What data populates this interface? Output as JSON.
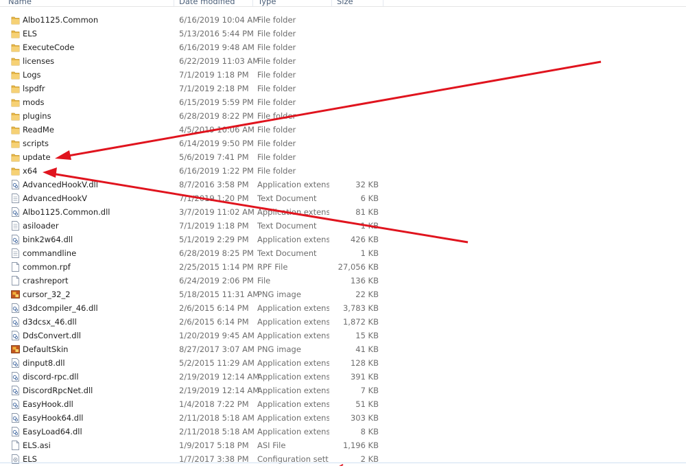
{
  "columns": {
    "name": "Name",
    "date_modified": "Date modified",
    "type": "Type",
    "size": "Size"
  },
  "files": [
    {
      "name": "Albo1125.Common",
      "date": "6/16/2019 10:04 AM",
      "type": "File folder",
      "size": "",
      "icon": "folder-icon"
    },
    {
      "name": "ELS",
      "date": "5/13/2016 5:44 PM",
      "type": "File folder",
      "size": "",
      "icon": "folder-icon"
    },
    {
      "name": "ExecuteCode",
      "date": "6/16/2019 9:48 AM",
      "type": "File folder",
      "size": "",
      "icon": "folder-icon"
    },
    {
      "name": "licenses",
      "date": "6/22/2019 11:03 AM",
      "type": "File folder",
      "size": "",
      "icon": "folder-icon"
    },
    {
      "name": "Logs",
      "date": "7/1/2019 1:18 PM",
      "type": "File folder",
      "size": "",
      "icon": "folder-icon"
    },
    {
      "name": "lspdfr",
      "date": "7/1/2019 2:18 PM",
      "type": "File folder",
      "size": "",
      "icon": "folder-icon"
    },
    {
      "name": "mods",
      "date": "6/15/2019 5:59 PM",
      "type": "File folder",
      "size": "",
      "icon": "folder-icon"
    },
    {
      "name": "plugins",
      "date": "6/28/2019 8:22 PM",
      "type": "File folder",
      "size": "",
      "icon": "folder-icon"
    },
    {
      "name": "ReadMe",
      "date": "4/5/2019 10:06 AM",
      "type": "File folder",
      "size": "",
      "icon": "folder-icon"
    },
    {
      "name": "scripts",
      "date": "6/14/2019 9:50 PM",
      "type": "File folder",
      "size": "",
      "icon": "folder-icon"
    },
    {
      "name": "update",
      "date": "5/6/2019 7:41 PM",
      "type": "File folder",
      "size": "",
      "icon": "folder-icon"
    },
    {
      "name": "x64",
      "date": "6/16/2019 1:22 PM",
      "type": "File folder",
      "size": "",
      "icon": "folder-icon"
    },
    {
      "name": "AdvancedHookV.dll",
      "date": "8/7/2016 3:58 PM",
      "type": "Application extens...",
      "size": "32 KB",
      "icon": "dll-icon"
    },
    {
      "name": "AdvancedHookV",
      "date": "7/1/2019 1:20 PM",
      "type": "Text Document",
      "size": "6 KB",
      "icon": "text-file-icon"
    },
    {
      "name": "Albo1125.Common.dll",
      "date": "3/7/2019 11:02 AM",
      "type": "Application extens...",
      "size": "81 KB",
      "icon": "dll-icon"
    },
    {
      "name": "asiloader",
      "date": "7/1/2019 1:18 PM",
      "type": "Text Document",
      "size": "1 KB",
      "icon": "text-file-icon"
    },
    {
      "name": "bink2w64.dll",
      "date": "5/1/2019 2:29 PM",
      "type": "Application extens...",
      "size": "426 KB",
      "icon": "dll-icon"
    },
    {
      "name": "commandline",
      "date": "6/28/2019 8:25 PM",
      "type": "Text Document",
      "size": "1 KB",
      "icon": "text-file-icon"
    },
    {
      "name": "common.rpf",
      "date": "2/25/2015 1:14 PM",
      "type": "RPF File",
      "size": "27,056 KB",
      "icon": "generic-file-icon"
    },
    {
      "name": "crashreport",
      "date": "6/24/2019 2:06 PM",
      "type": "File",
      "size": "136 KB",
      "icon": "generic-file-icon"
    },
    {
      "name": "cursor_32_2",
      "date": "5/18/2015 11:31 AM",
      "type": "PNG image",
      "size": "22 KB",
      "icon": "png-image-icon"
    },
    {
      "name": "d3dcompiler_46.dll",
      "date": "2/6/2015 6:14 PM",
      "type": "Application extens...",
      "size": "3,783 KB",
      "icon": "dll-icon"
    },
    {
      "name": "d3dcsx_46.dll",
      "date": "2/6/2015 6:14 PM",
      "type": "Application extens...",
      "size": "1,872 KB",
      "icon": "dll-icon"
    },
    {
      "name": "DdsConvert.dll",
      "date": "1/20/2019 9:45 AM",
      "type": "Application extens...",
      "size": "15 KB",
      "icon": "dll-icon"
    },
    {
      "name": "DefaultSkin",
      "date": "8/27/2017 3:07 AM",
      "type": "PNG image",
      "size": "41 KB",
      "icon": "png-image-icon"
    },
    {
      "name": "dinput8.dll",
      "date": "5/2/2015 11:29 AM",
      "type": "Application extens...",
      "size": "128 KB",
      "icon": "dll-icon"
    },
    {
      "name": "discord-rpc.dll",
      "date": "2/19/2019 12:14 AM",
      "type": "Application extens...",
      "size": "391 KB",
      "icon": "dll-icon"
    },
    {
      "name": "DiscordRpcNet.dll",
      "date": "2/19/2019 12:14 AM",
      "type": "Application extens...",
      "size": "7 KB",
      "icon": "dll-icon"
    },
    {
      "name": "EasyHook.dll",
      "date": "1/4/2018 7:22 PM",
      "type": "Application extens...",
      "size": "51 KB",
      "icon": "dll-icon"
    },
    {
      "name": "EasyHook64.dll",
      "date": "2/11/2018 5:18 AM",
      "type": "Application extens...",
      "size": "303 KB",
      "icon": "dll-icon"
    },
    {
      "name": "EasyLoad64.dll",
      "date": "2/11/2018 5:18 AM",
      "type": "Application extens...",
      "size": "8 KB",
      "icon": "dll-icon"
    },
    {
      "name": "ELS.asi",
      "date": "1/9/2017 5:18 PM",
      "type": "ASI File",
      "size": "1,196 KB",
      "icon": "generic-file-icon"
    },
    {
      "name": "ELS",
      "date": "1/7/2017 3:38 PM",
      "type": "Configuration sett...",
      "size": "2 KB",
      "icon": "config-file-icon"
    }
  ],
  "annotation_color": "#e0141e"
}
